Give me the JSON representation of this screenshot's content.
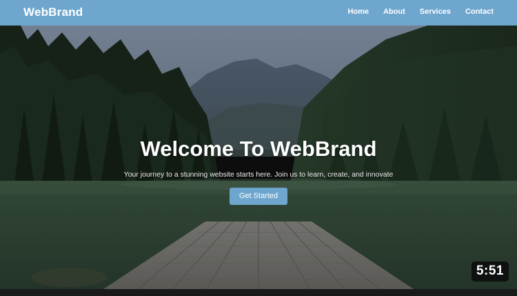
{
  "navbar": {
    "brand": "WebBrand",
    "links": [
      "Home",
      "About",
      "Services",
      "Contact"
    ],
    "background": "#6ea6cd"
  },
  "hero": {
    "title": "Welcome To WebBrand",
    "subtitle": "Your journey to a stunning website starts here. Join us to learn, create, and innovate",
    "cta_label": "Get Started",
    "cta_color": "#6ea6cd"
  },
  "video": {
    "duration": "5:51"
  }
}
